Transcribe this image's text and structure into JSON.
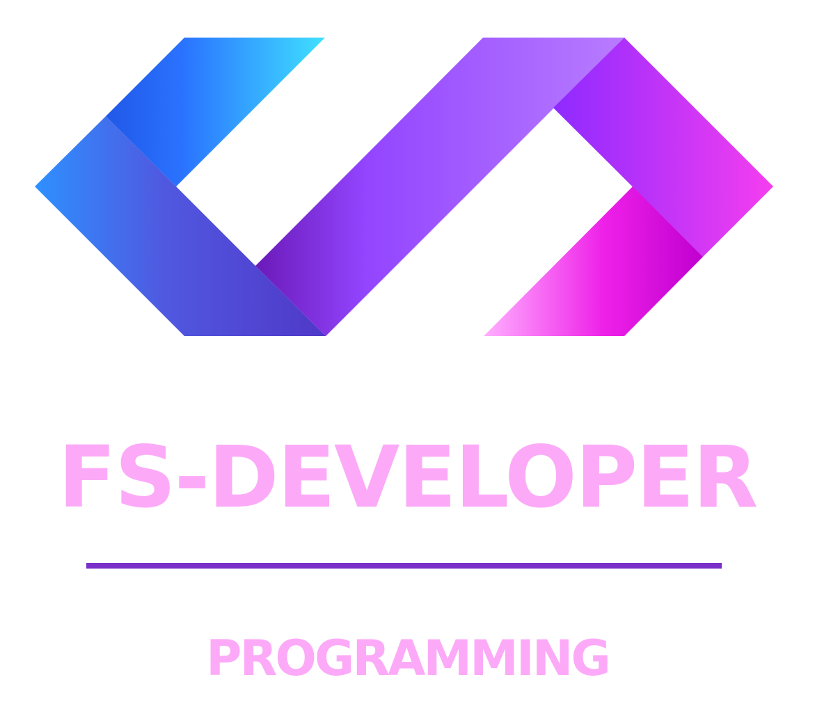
{
  "logo": {
    "icon": "code-brackets-ribbon-icon",
    "title": "FS-DEVELOPER",
    "tagline": "PROGRAMMING"
  },
  "colors": {
    "text": "#fcaaf8",
    "divider": "#7b2fc9",
    "blue_light": "#40e0ff",
    "blue": "#2a73ff",
    "indigo": "#5040d0",
    "purple_dark": "#6a1ab8",
    "purple": "#9b4bff",
    "lavender": "#b87cff",
    "violet": "#8e2aff",
    "magenta": "#f53ef0",
    "pink_light": "#ffaaff",
    "magenta_dark": "#c000d0"
  }
}
